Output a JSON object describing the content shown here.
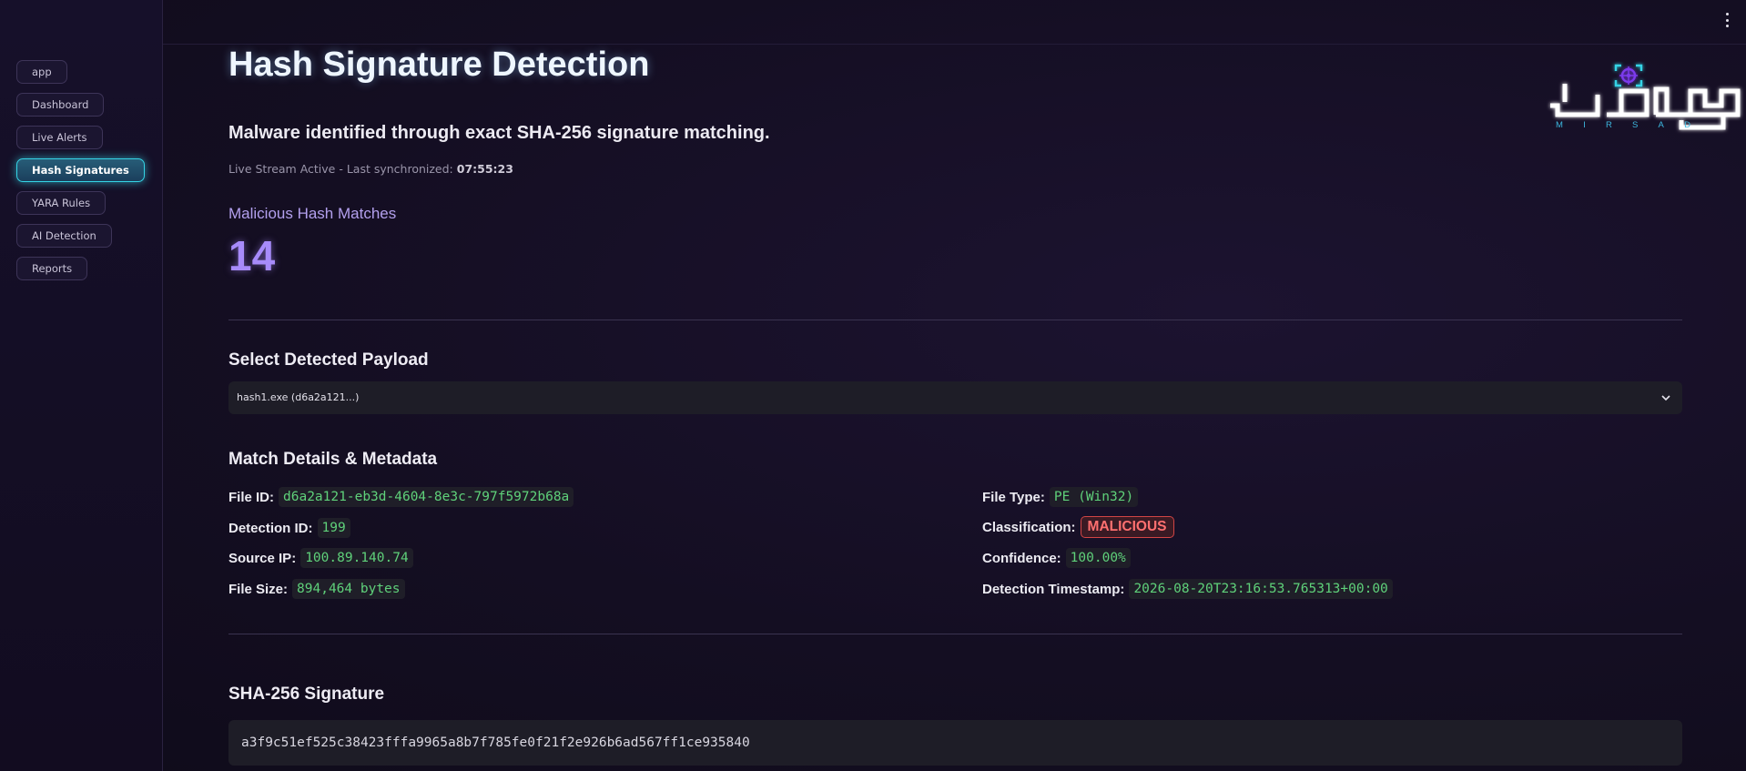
{
  "sidebar": {
    "items": [
      {
        "label": "app"
      },
      {
        "label": "Dashboard"
      },
      {
        "label": "Live Alerts"
      },
      {
        "label": "Hash Signatures"
      },
      {
        "label": "YARA Rules"
      },
      {
        "label": "AI Detection"
      },
      {
        "label": "Reports"
      }
    ],
    "active": "Hash Signatures"
  },
  "header": {
    "title": "Hash Signature Detection",
    "subtitle": "Malware identified through exact SHA-256 signature matching.",
    "sync_prefix": "Live Stream Active - Last synchronized: ",
    "sync_time": "07:55:23"
  },
  "logo": {
    "letters": [
      "M",
      "I",
      "R",
      "S",
      "A",
      "D"
    ],
    "glow_color": "#ffffff",
    "accent_color": "#7c3aed"
  },
  "metric": {
    "label": "Malicious Hash Matches",
    "value": "14"
  },
  "payload_select": {
    "title": "Select Detected Payload",
    "selected": "hash1.exe (d6a2a121...)"
  },
  "details": {
    "title": "Match Details & Metadata",
    "left": [
      {
        "key": "File ID:",
        "value": "d6a2a121-eb3d-4604-8e3c-797f5972b68a"
      },
      {
        "key": "Detection ID:",
        "value": "199"
      },
      {
        "key": "Source IP:",
        "value": "100.89.140.74"
      },
      {
        "key": "File Size:",
        "value": "894,464 bytes"
      }
    ],
    "right": [
      {
        "key": "File Type:",
        "value": "PE (Win32)"
      },
      {
        "key": "Classification:",
        "value": "MALICIOUS"
      },
      {
        "key": "Confidence:",
        "value": "100.00%"
      },
      {
        "key": "Detection Timestamp:",
        "value": "2026-08-20T23:16:53.765313+00:00"
      }
    ]
  },
  "signature": {
    "title": "SHA-256 Signature",
    "hash": "a3f9c51ef525c38423fffa9965a8b7f785fe0f21f2e926b6ad567ff1ce935840"
  },
  "colors": {
    "accent_cyan": "#35d4e6",
    "metric_purple": "#a78bfa",
    "code_green": "#5fd17a",
    "danger_red": "#ff7070"
  }
}
